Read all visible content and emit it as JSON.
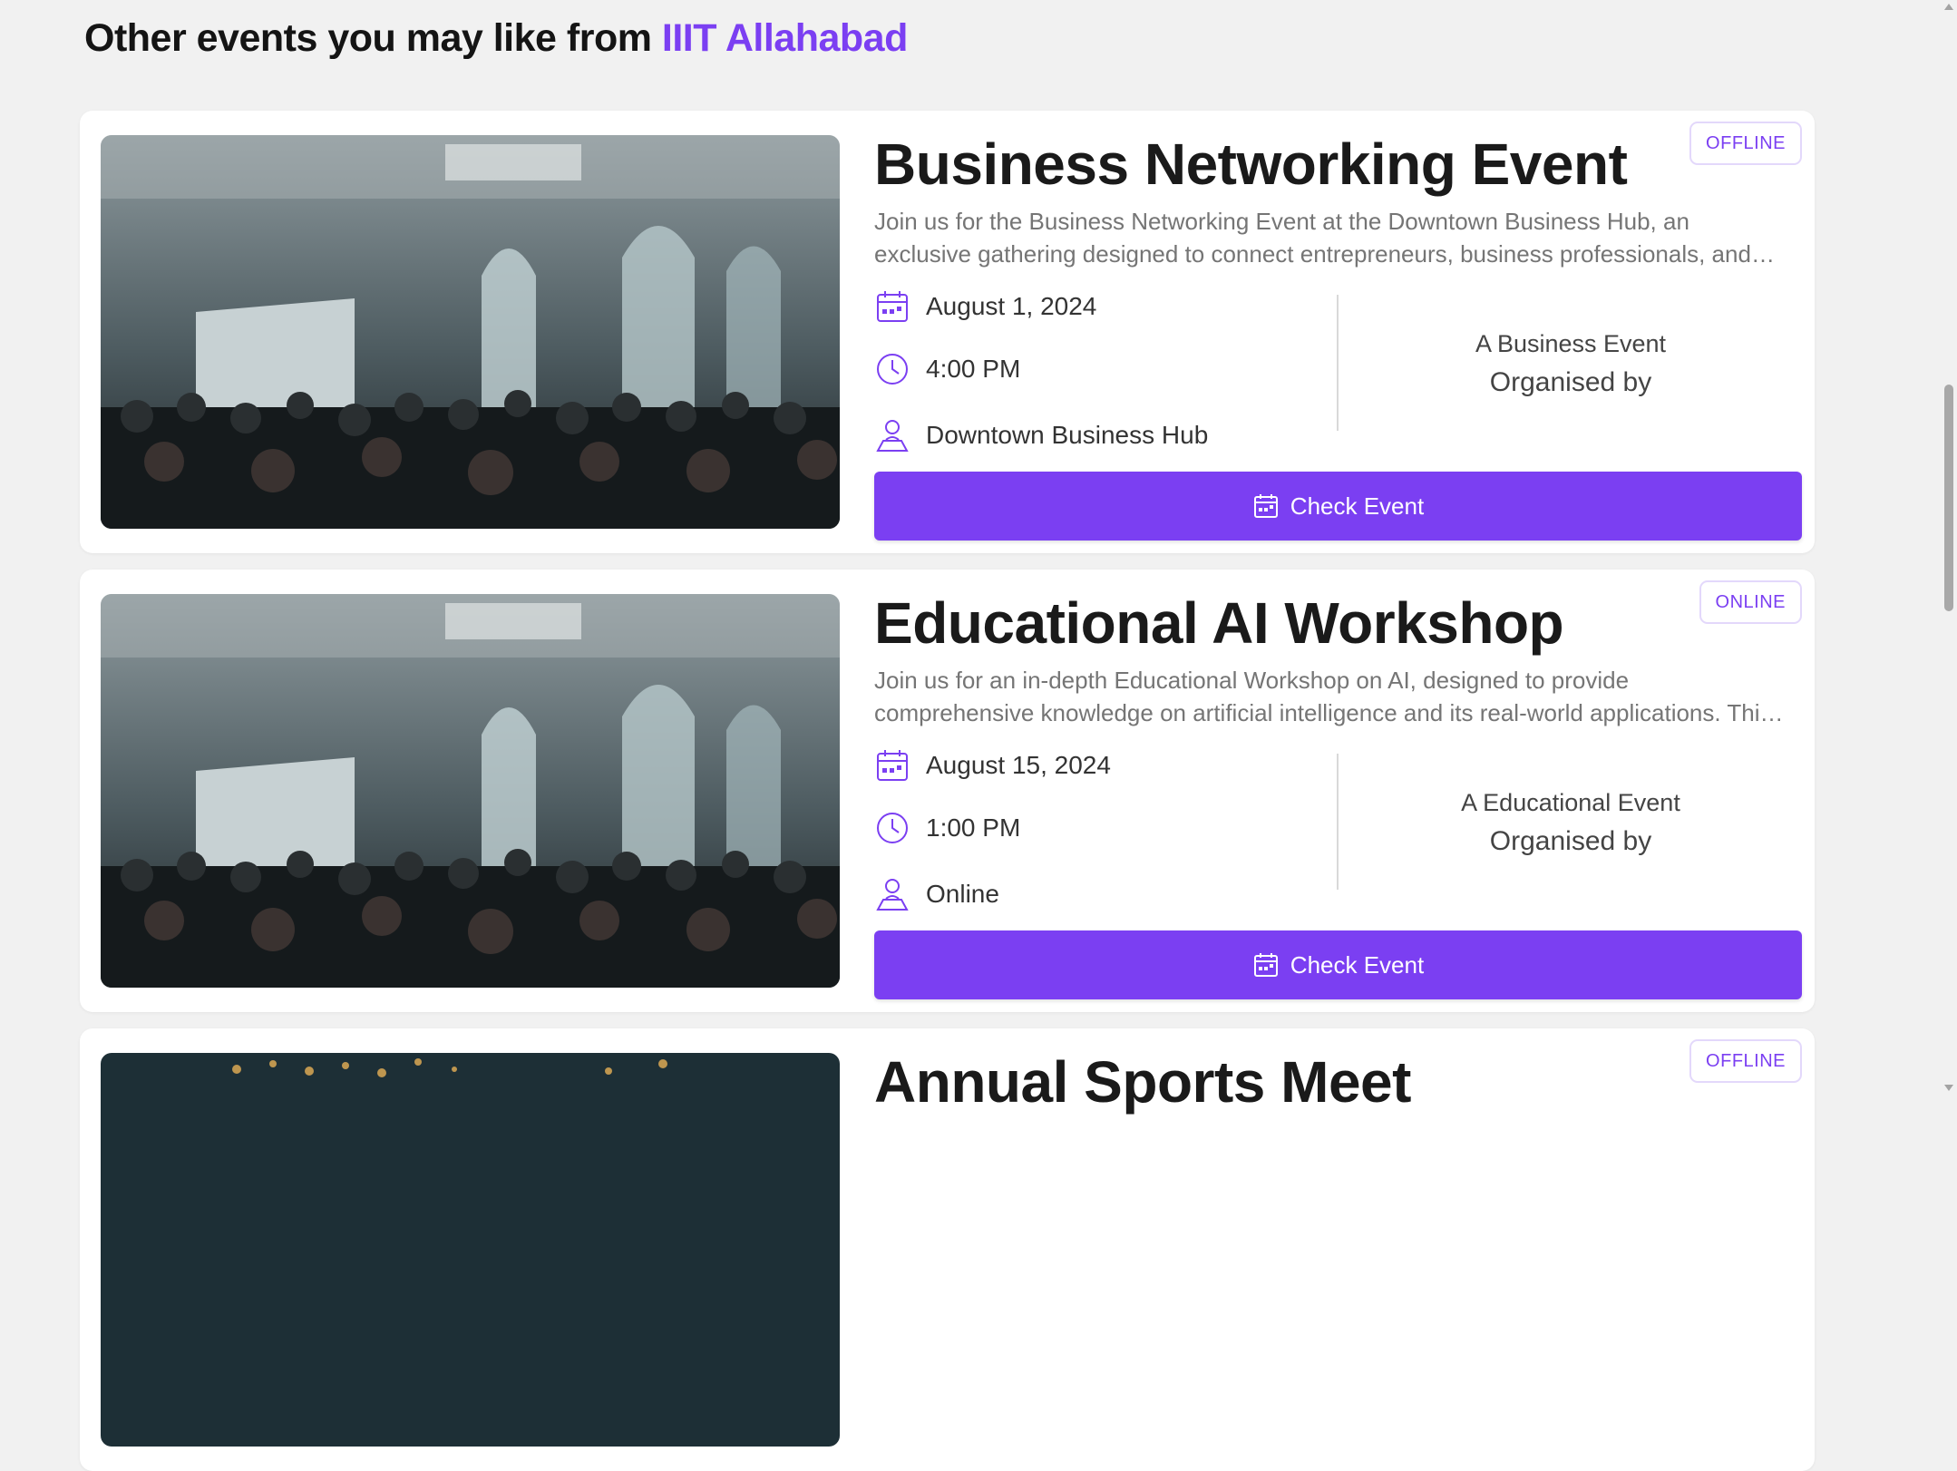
{
  "section": {
    "heading_prefix": "Other events you may like from",
    "heading_org": "IIIT Allahabad"
  },
  "colors": {
    "accent": "#7b3ff2",
    "background": "#f1f1f1",
    "card": "#ffffff",
    "muted_text": "#757575"
  },
  "icons": {
    "date": "calendar-icon",
    "time": "clock-icon",
    "venue": "person-pin-icon",
    "button": "calendar-icon"
  },
  "events": [
    {
      "mode": "OFFLINE",
      "title": "Business Networking Event",
      "description": "Join us for the Business Networking Event at the Downtown Business Hub, an exclusive gathering designed to connect entrepreneurs, business professionals, and industry...",
      "date": "August 1, 2024",
      "time": "4:00 PM",
      "venue": "Downtown Business Hub",
      "category": "A Business Event",
      "organised_by": "Organised by",
      "button": "Check Event"
    },
    {
      "mode": "ONLINE",
      "title": "Educational AI Workshop",
      "description": "Join us for an in-depth Educational Workshop on AI, designed to provide comprehensive knowledge on artificial intelligence and its real-world applications. This online workshop ...",
      "date": "August 15, 2024",
      "time": "1:00 PM",
      "venue": "Online",
      "category": "A Educational Event",
      "organised_by": "Organised by",
      "button": "Check Event"
    },
    {
      "mode": "OFFLINE",
      "title": "Annual Sports Meet"
    }
  ]
}
